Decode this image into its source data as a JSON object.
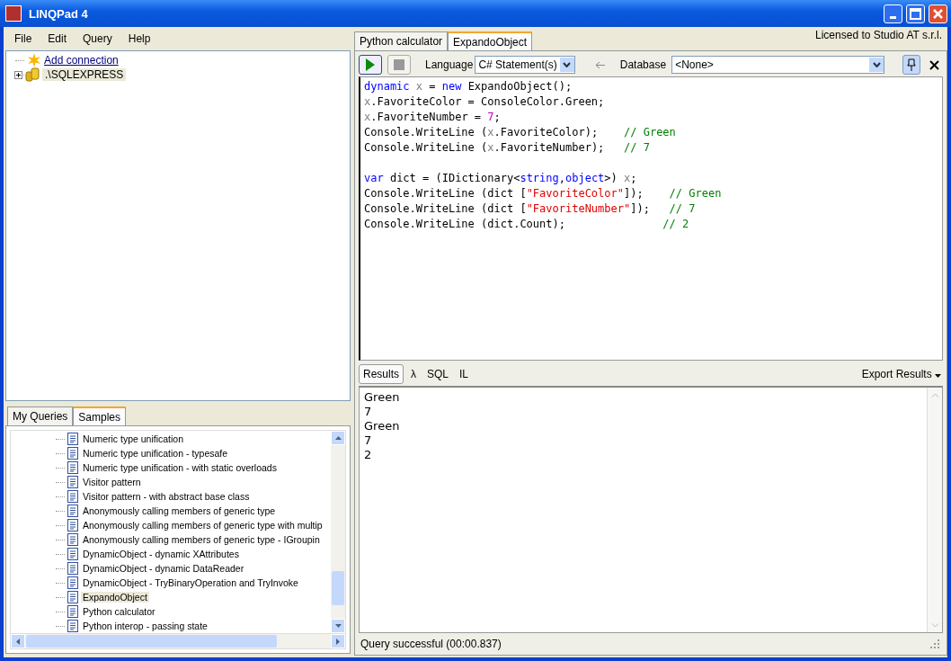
{
  "window": {
    "title": "LINQPad 4"
  },
  "menu": [
    "File",
    "Edit",
    "Query",
    "Help"
  ],
  "connections": [
    {
      "label": "Add connection",
      "kind": "link",
      "selected": false
    },
    {
      "label": ".\\SQLEXPRESS",
      "kind": "server",
      "selected": true
    }
  ],
  "left_tabs": [
    {
      "label": "My Queries",
      "selected": false
    },
    {
      "label": "Samples",
      "selected": true
    }
  ],
  "samples": [
    {
      "label": "Numeric type unification",
      "selected": false
    },
    {
      "label": "Numeric type unification - typesafe",
      "selected": false
    },
    {
      "label": "Numeric type unification - with static overloads",
      "selected": false
    },
    {
      "label": "Visitor pattern",
      "selected": false
    },
    {
      "label": "Visitor pattern - with abstract base class",
      "selected": false
    },
    {
      "label": "Anonymously calling members of generic type",
      "selected": false
    },
    {
      "label": "Anonymously calling members of generic type with multip",
      "selected": false
    },
    {
      "label": "Anonymously calling members of generic type - IGroupin",
      "selected": false
    },
    {
      "label": "DynamicObject - dynamic XAttributes",
      "selected": false
    },
    {
      "label": "DynamicObject - dynamic DataReader",
      "selected": false
    },
    {
      "label": "DynamicObject - TryBinaryOperation and TryInvoke",
      "selected": false
    },
    {
      "label": "ExpandoObject",
      "selected": true
    },
    {
      "label": "Python calculator",
      "selected": false
    },
    {
      "label": "Python interop - passing state",
      "selected": false
    }
  ],
  "query_tabs": [
    {
      "label": "Python calculator",
      "selected": false
    },
    {
      "label": "ExpandoObject",
      "selected": true
    }
  ],
  "license": "Licensed to Studio AT s.r.l.",
  "toolbar": {
    "language_label": "Language",
    "language": "C# Statement(s)",
    "database_label": "Database",
    "database": "<None>"
  },
  "code": [
    {
      "tokens": [
        {
          "kind": "kw",
          "text": "dynamic"
        },
        {
          "kind": "var",
          "text": " x "
        },
        {
          "kind": "plain",
          "text": "= "
        },
        {
          "kind": "kw",
          "text": "new"
        },
        {
          "kind": "plain",
          "text": " ExpandoObject();"
        }
      ]
    },
    {
      "tokens": [
        {
          "kind": "var",
          "text": "x"
        },
        {
          "kind": "plain",
          "text": ".FavoriteColor = ConsoleColor.Green;"
        }
      ]
    },
    {
      "tokens": [
        {
          "kind": "var",
          "text": "x"
        },
        {
          "kind": "plain",
          "text": ".FavoriteNumber = "
        },
        {
          "kind": "num",
          "text": "7"
        },
        {
          "kind": "plain",
          "text": ";"
        }
      ]
    },
    {
      "tokens": [
        {
          "kind": "plain",
          "text": "Console.WriteLine ("
        },
        {
          "kind": "var",
          "text": "x"
        },
        {
          "kind": "plain",
          "text": ".FavoriteColor);    "
        },
        {
          "kind": "comment",
          "text": "// Green"
        }
      ]
    },
    {
      "tokens": [
        {
          "kind": "plain",
          "text": "Console.WriteLine ("
        },
        {
          "kind": "var",
          "text": "x"
        },
        {
          "kind": "plain",
          "text": ".FavoriteNumber);   "
        },
        {
          "kind": "comment",
          "text": "// 7"
        }
      ]
    },
    {
      "gap_before": true,
      "tokens": [
        {
          "kind": "kw",
          "text": "var"
        },
        {
          "kind": "plain",
          "text": " dict = (IDictionary<"
        },
        {
          "kind": "kw",
          "text": "string"
        },
        {
          "kind": "plain",
          "text": ","
        },
        {
          "kind": "kw",
          "text": "object"
        },
        {
          "kind": "plain",
          "text": ">) "
        },
        {
          "kind": "var",
          "text": "x"
        },
        {
          "kind": "plain",
          "text": ";"
        }
      ]
    },
    {
      "tokens": [
        {
          "kind": "plain",
          "text": "Console.WriteLine (dict ["
        },
        {
          "kind": "str",
          "text": "\"FavoriteColor\""
        },
        {
          "kind": "plain",
          "text": "]);    "
        },
        {
          "kind": "comment",
          "text": "// Green"
        }
      ]
    },
    {
      "tokens": [
        {
          "kind": "plain",
          "text": "Console.WriteLine (dict ["
        },
        {
          "kind": "str",
          "text": "\"FavoriteNumber\""
        },
        {
          "kind": "plain",
          "text": "]);   "
        },
        {
          "kind": "comment",
          "text": "// 7"
        }
      ]
    },
    {
      "tokens": [
        {
          "kind": "plain",
          "text": "Console.WriteLine (dict.Count);               "
        },
        {
          "kind": "comment",
          "text": "// 2"
        }
      ]
    }
  ],
  "result_tabs": [
    {
      "label": "Results",
      "selected": true
    },
    {
      "label": "λ",
      "selected": false
    },
    {
      "label": "SQL",
      "selected": false
    },
    {
      "label": "IL",
      "selected": false
    }
  ],
  "export": "Export Results",
  "results": [
    "Green",
    "7",
    "Green",
    "7",
    "2"
  ],
  "status": "Query successful  (00:00.837)"
}
